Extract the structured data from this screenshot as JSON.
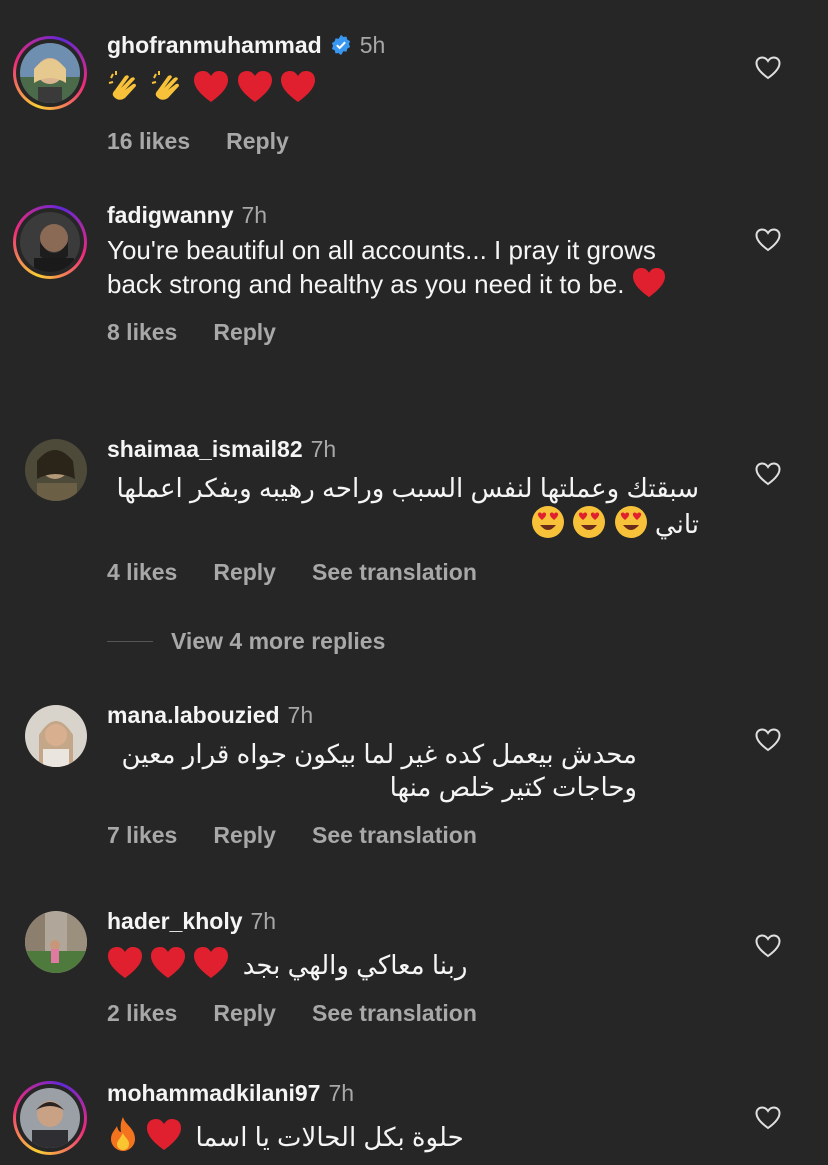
{
  "comments": [
    {
      "username": "ghofranmuhammad",
      "verified": true,
      "time": "5h",
      "text": "",
      "likes": "16 likes",
      "reply": "Reply",
      "translate": ""
    },
    {
      "username": "fadigwanny",
      "verified": false,
      "time": "7h",
      "text": "You're beautiful on all accounts... I pray it grows back strong and healthy as you need it to be.",
      "likes": "8 likes",
      "reply": "Reply",
      "translate": ""
    },
    {
      "username": "shaimaa_ismail82",
      "verified": false,
      "time": "7h",
      "text": "سبقتك وعملتها لنفس السبب وراحه رهيبه وبفكر اعملها تاني",
      "likes": "4 likes",
      "reply": "Reply",
      "translate": "See translation"
    },
    {
      "username": "mana.labouzied",
      "verified": false,
      "time": "7h",
      "text": "محدش بيعمل كده غير لما بيكون جواه قرار معين وحاجات كتير خلص منها",
      "likes": "7 likes",
      "reply": "Reply",
      "translate": "See translation"
    },
    {
      "username": "hader_kholy",
      "verified": false,
      "time": "7h",
      "text": "ربنا معاكي والهي بجد",
      "likes": "2 likes",
      "reply": "Reply",
      "translate": "See translation"
    },
    {
      "username": "mohammadkilani97",
      "verified": false,
      "time": "7h",
      "text": "حلوة بكل الحالات يا اسما",
      "likes": "",
      "reply": "",
      "translate": ""
    }
  ],
  "view_more_replies": "View 4 more replies",
  "colors": {
    "background": "#262626",
    "text": "#f5f5f5",
    "muted": "#a8a8a8",
    "heart": "#e0202e",
    "verified": "#3897f0"
  },
  "icons": {
    "like": "heart-outline-icon",
    "verified": "verified-badge-icon"
  }
}
